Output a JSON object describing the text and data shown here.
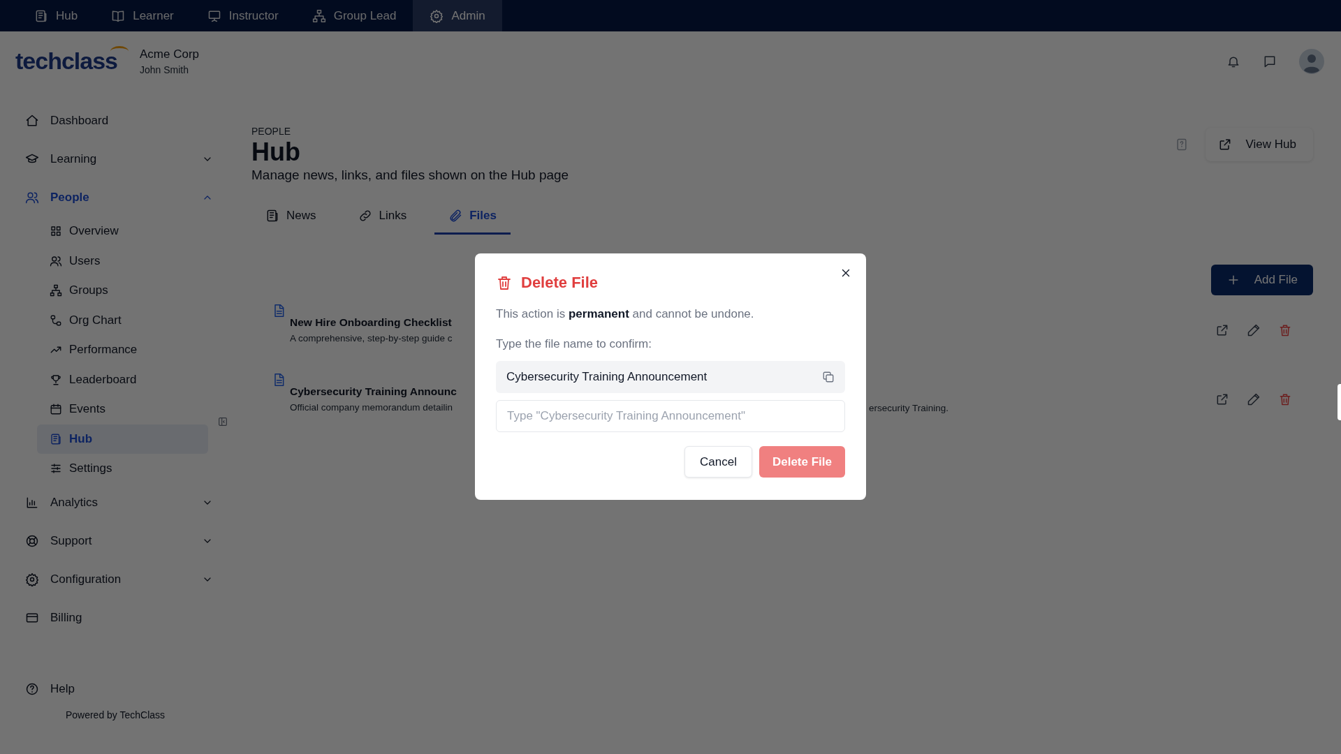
{
  "top_nav": [
    {
      "label": "Hub",
      "selected": false
    },
    {
      "label": "Learner",
      "selected": false
    },
    {
      "label": "Instructor",
      "selected": false
    },
    {
      "label": "Group Lead",
      "selected": false
    },
    {
      "label": "Admin",
      "selected": true
    }
  ],
  "header": {
    "logo": "techclass",
    "company": "Acme Corp",
    "user": "John Smith"
  },
  "sidebar": {
    "items": [
      {
        "label": "Dashboard",
        "selected": false
      },
      {
        "label": "Learning",
        "selected": false,
        "expanded": false
      },
      {
        "label": "People",
        "selected": true,
        "expanded": true,
        "children": [
          {
            "label": "Overview",
            "selected": false
          },
          {
            "label": "Users",
            "selected": false
          },
          {
            "label": "Groups",
            "selected": false
          },
          {
            "label": "Org Chart",
            "selected": false
          },
          {
            "label": "Performance",
            "selected": false
          },
          {
            "label": "Leaderboard",
            "selected": false
          },
          {
            "label": "Events",
            "selected": false
          },
          {
            "label": "Hub",
            "selected": true
          },
          {
            "label": "Settings",
            "selected": false
          }
        ]
      },
      {
        "label": "Analytics",
        "selected": false,
        "expanded": false
      },
      {
        "label": "Support",
        "selected": false,
        "expanded": false
      },
      {
        "label": "Configuration",
        "selected": false,
        "expanded": false
      },
      {
        "label": "Billing",
        "selected": false
      }
    ],
    "help": "Help",
    "footer": "Powered by TechClass"
  },
  "page": {
    "eyebrow": "PEOPLE",
    "title": "Hub",
    "subtitle": "Manage news, links, and files shown on the Hub page",
    "view_button": "View Hub"
  },
  "tabs": [
    {
      "label": "News",
      "selected": false
    },
    {
      "label": "Links",
      "selected": false
    },
    {
      "label": "Files",
      "selected": true
    }
  ],
  "add_button": "Add File",
  "files": [
    {
      "title": "New Hire Onboarding Checklist",
      "description": "A comprehensive, step-by-step guide c"
    },
    {
      "title": "Cybersecurity Training Announc",
      "description": "Official company memorandum detailin",
      "description_end": "ersecurity Training."
    }
  ],
  "dialog": {
    "title": "Delete File",
    "message": "This action is **permanent** and cannot be undone.",
    "prompt": "Type the file name to confirm:",
    "file_name": "Cybersecurity Training Announcement",
    "placeholder": "Type \"Cybersecurity Training Announcement\"",
    "buttons": [
      {
        "label": "Cancel",
        "kind": "secondary",
        "disabled": false
      },
      {
        "label": "Delete File",
        "kind": "danger",
        "disabled": true
      }
    ]
  }
}
